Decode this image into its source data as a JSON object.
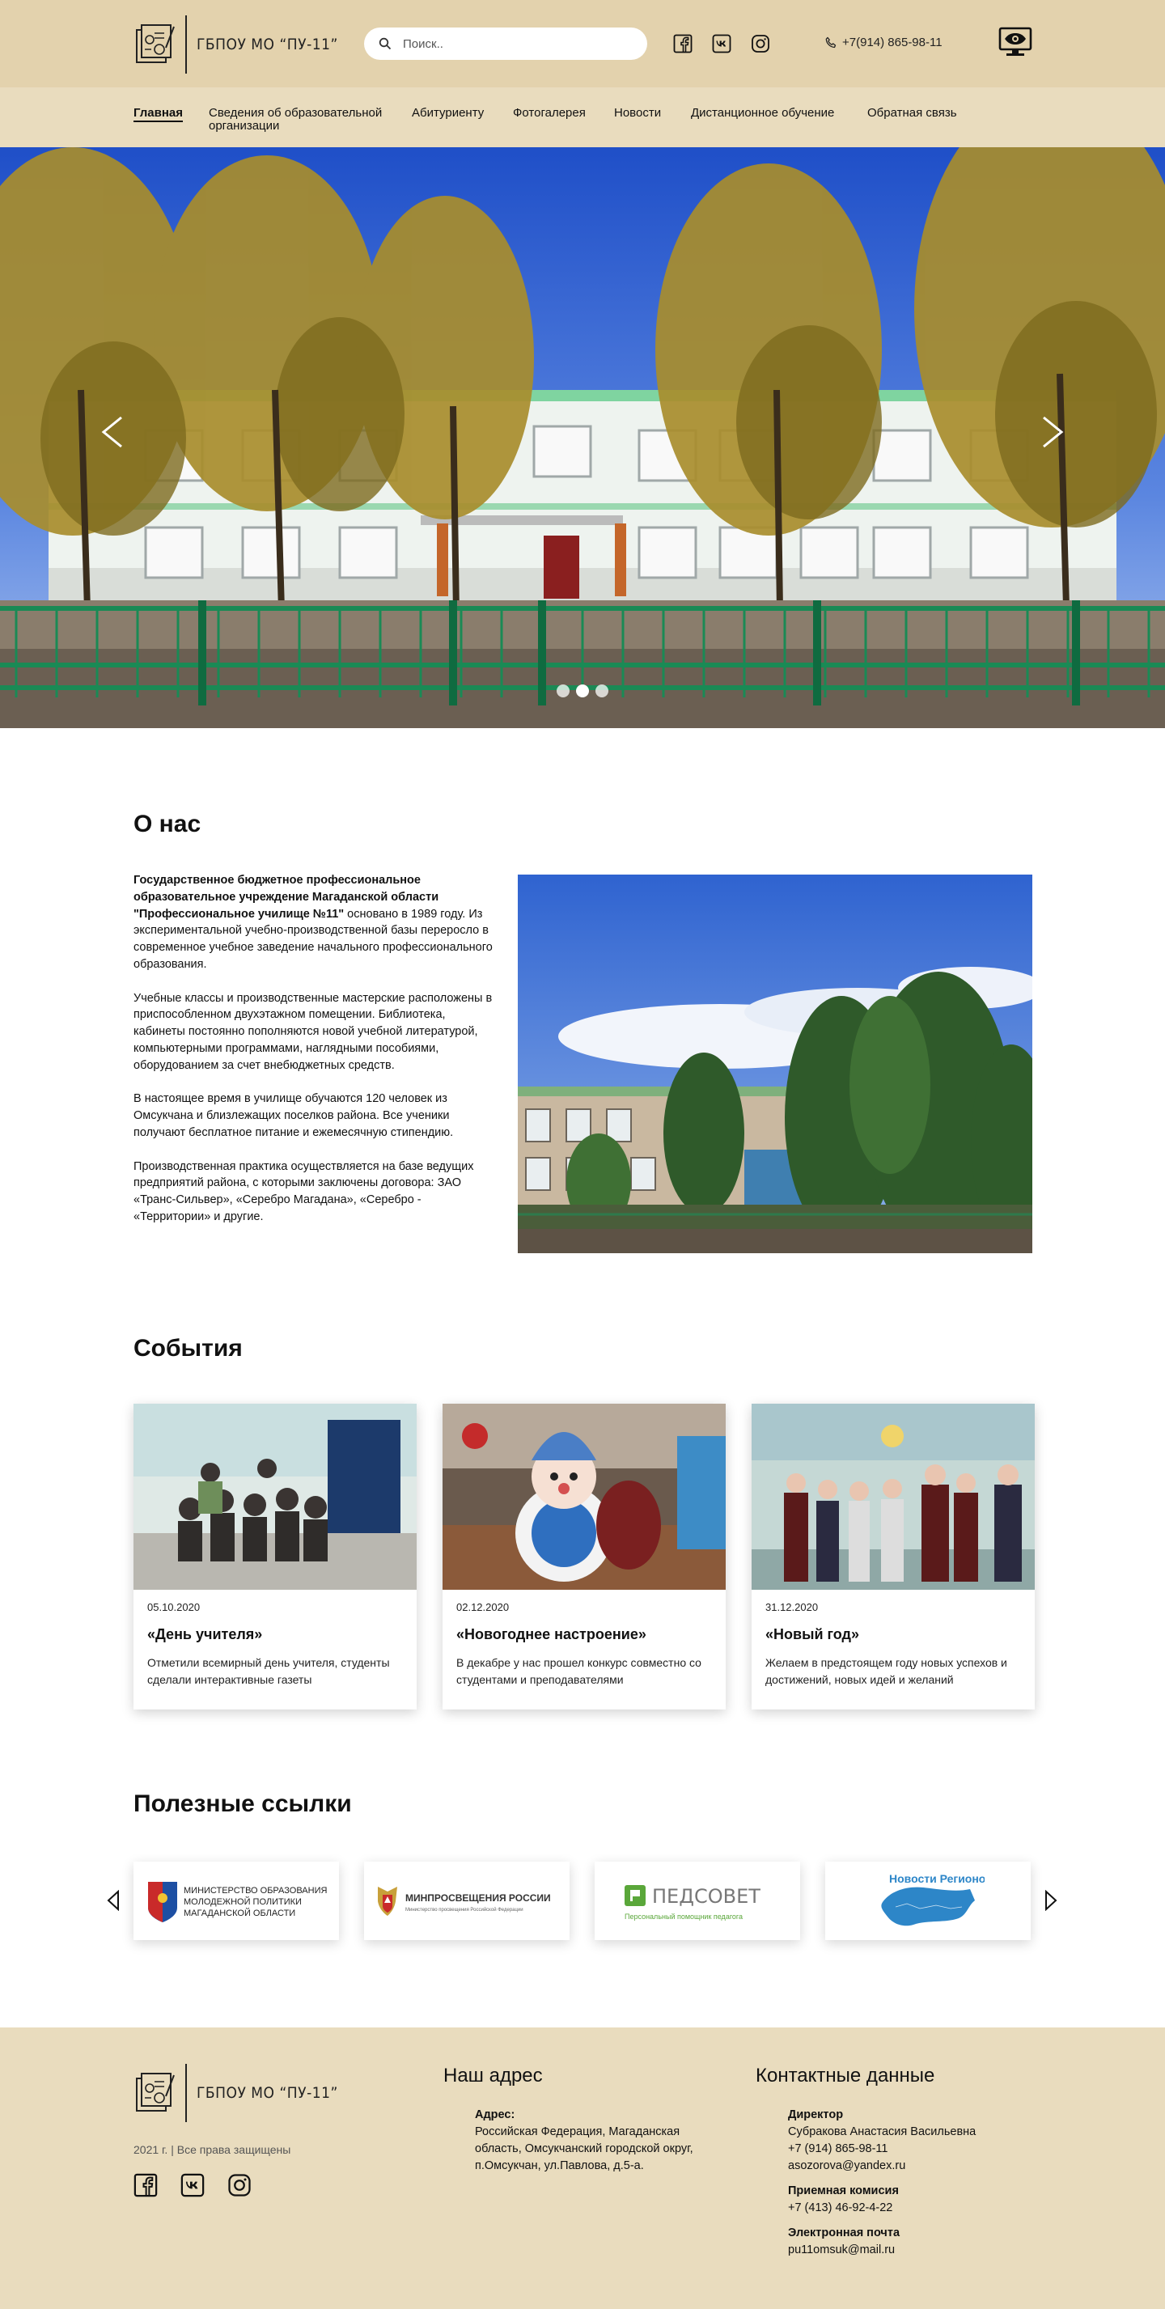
{
  "header": {
    "logo_text": "ГБПОУ МО “ПУ-11”",
    "search_placeholder": "Поиск..",
    "phone": "+7(914) 865-98-11"
  },
  "nav": {
    "items": [
      "Главная",
      "Сведения об образовательной организации",
      "Абитуриенту",
      "Фотогалерея",
      "Новости",
      "Дистанционное обучение",
      "Обратная связь"
    ]
  },
  "hero": {
    "slides": 3,
    "active_slide": 2
  },
  "about": {
    "title": "О нас",
    "intro_bold": "Государственное бюджетное профессиональное образовательное учреждение Магаданской области \"Профессиональное училище №11\"",
    "intro_rest": " основано в 1989 году. Из экспериментальной учебно-производственной базы переросло в современное учебное заведение начального профессионального образования.",
    "p2": "Учебные классы и производственные мастерские расположены в приспособленном двухэтажном помещении. Библиотека, кабинеты постоянно пополняются новой учебной литературой, компьютерными программами, наглядными пособиями, оборудованием за счет внебюджетных средств.",
    "p3": "В настоящее время в училище обучаются 120 человек из Омсукчана и близлежащих поселков района. Все ученики получают бесплатное питание и ежемесячную стипендию.",
    "p4": "Производственная практика осуществляется на базе ведущих предприятий района, с которыми заключены договора: ЗАО «Транс-Сильвер», «Серебро Магадана», «Серебро - «Территории» и другие."
  },
  "events": {
    "title": "События",
    "items": [
      {
        "date": "05.10.2020",
        "title": "«День учителя»",
        "text": "Отметили всемирный день учителя, студенты сделали интерактивные газеты"
      },
      {
        "date": "02.12.2020",
        "title": "«Новогоднее настроение»",
        "text": "В декабре у нас прошел конкурс совместно со студентами и преподавателями"
      },
      {
        "date": "31.12.2020",
        "title": "«Новый год»",
        "text": "Желаем в предстоящем году новых успехов и достижений, новых идей и желаний"
      }
    ]
  },
  "links": {
    "title": "Полезные ссылки",
    "items": [
      {
        "line1": "МИНИСТЕРСТВО ОБРАЗОВАНИЯ И",
        "line2": "МОЛОДЕЖНОЙ ПОЛИТИКИ",
        "line3": "МАГАДАНСКОЙ ОБЛАСТИ"
      },
      {
        "name": "МИНПРОСВЕЩЕНИЯ РОССИИ",
        "sub": "Министерство просвещения Российской Федерации"
      },
      {
        "name": "ПЕДСОВЕТ",
        "sub": "Персональный помощник педагога"
      },
      {
        "name": "Новости Регионов"
      }
    ]
  },
  "footer": {
    "logo_text": "ГБПОУ МО “ПУ-11”",
    "copyright": "2021 г. | Все права защищены",
    "address_title": "Наш адрес",
    "address_label": "Адрес:",
    "address_line1": "Российская Федерация, Магаданская",
    "address_line2": "область, Омсукчанский городской округ,",
    "address_line3": "п.Омсукчан, ул.Павлова, д.5-а.",
    "contacts_title": "Контактные данные",
    "director_label": "Директор",
    "director_name": "Субракова Анастасия Васильевна",
    "director_phone": "+7 (914) 865-98-11",
    "director_email": "asozorova@yandex.ru",
    "admission_label": "Приемная комисия",
    "admission_phone": "+7 (413) 46-92-4-22",
    "email_label": "Электронная почта",
    "email": "pu11omsuk@mail.ru"
  }
}
